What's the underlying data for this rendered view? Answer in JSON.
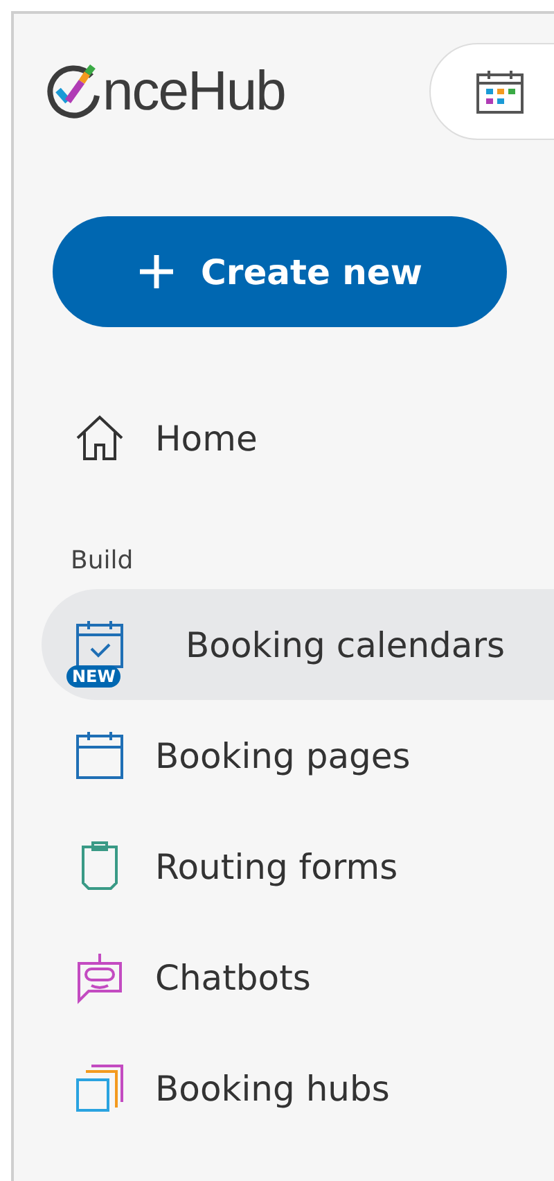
{
  "logo": {
    "text": "nceHub"
  },
  "create_button": {
    "label": "Create new"
  },
  "nav": [
    {
      "label": "Home",
      "kind": "home",
      "selected": false
    }
  ],
  "section": {
    "title": "Build",
    "items": [
      {
        "label": "Booking calendars",
        "kind": "calendar",
        "badge": "NEW",
        "selected": true
      },
      {
        "label": "Booking pages",
        "kind": "pages",
        "selected": false
      },
      {
        "label": "Routing forms",
        "kind": "form",
        "selected": false
      },
      {
        "label": "Chatbots",
        "kind": "chatbot",
        "selected": false
      },
      {
        "label": "Booking hubs",
        "kind": "hubs",
        "selected": false
      }
    ]
  }
}
